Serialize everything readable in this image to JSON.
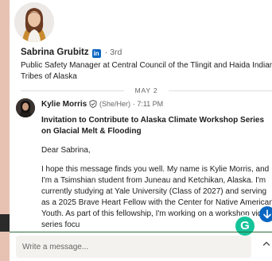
{
  "profile": {
    "name": "Sabrina Grubitz",
    "badge": "in",
    "degree": "· 3rd",
    "headline": "Public Safety Manager at Central Council of the Tlingit and Haida Indian Tribes of Alaska",
    "avatar_icon": "profile-photo-avatar"
  },
  "conversation": {
    "date_divider": "MAY 2",
    "message": {
      "sender": "Kylie Morris",
      "verified_icon": "shield-check-icon",
      "pronouns": "(She/Her)",
      "time": "· 7:11 PM",
      "subject": "Invitation to Contribute to Alaska Climate Workshop Series on Glacial Melt & Flooding",
      "greeting": "Dear Sabrina,",
      "body": "I hope this message finds you well. My name is Kylie Morris, and I'm a Tsimshian student from Juneau and Ketchikan, Alaska. I'm currently studying at Yale University (Class of 2027) and serving as a 2025 Brave Heart Fellow with the Center for Native American Youth. As part of this fellowship, I'm working on a workshop video series focu"
    }
  },
  "compose": {
    "placeholder": "Write a message..."
  },
  "widgets": {
    "grammarly_label": "G",
    "scroll_down_icon": "arrow-down-icon",
    "expand_icon": "chevron-up-icon"
  },
  "colors": {
    "linkedin_blue": "#0a66c2",
    "grammarly_green": "#15c39a",
    "text_primary": "#1d1d1d",
    "text_secondary": "#666666"
  }
}
